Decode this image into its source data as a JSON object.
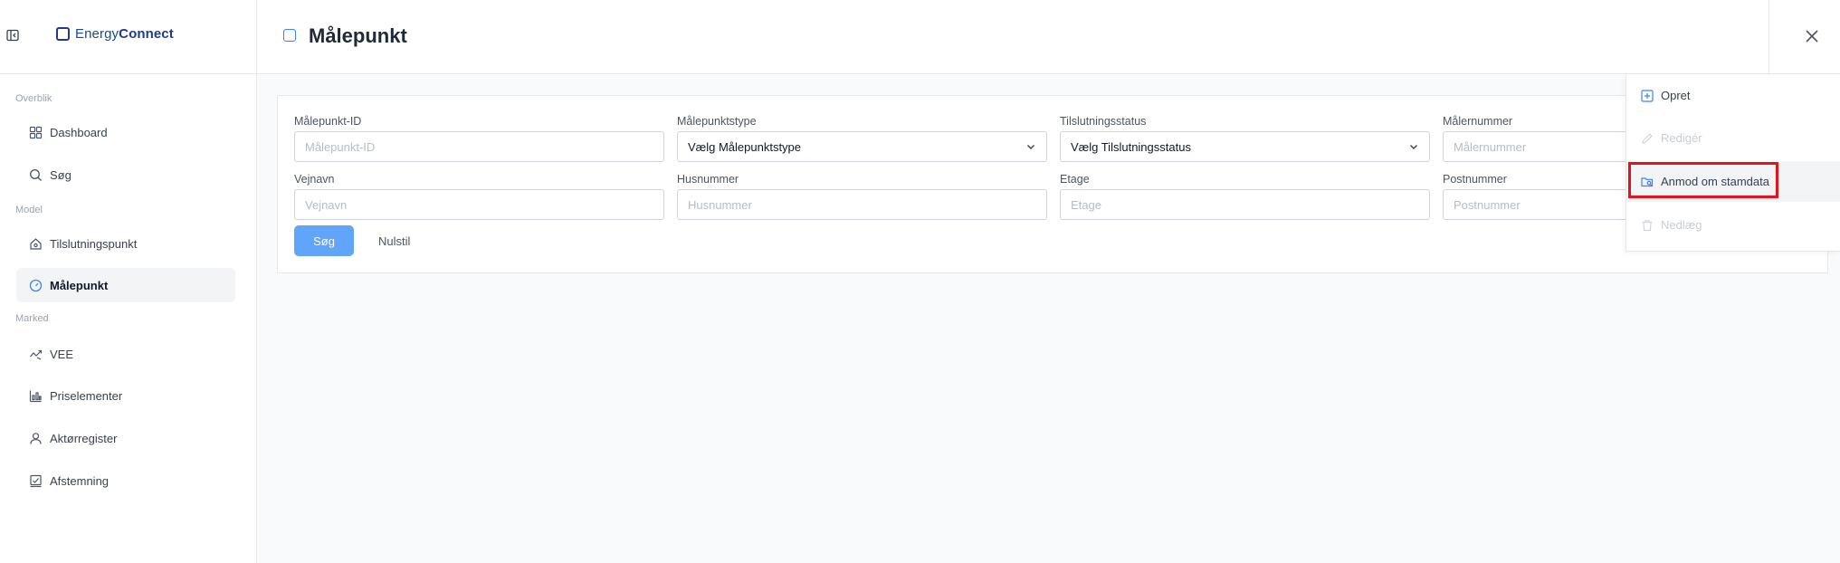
{
  "sidebar": {
    "logo": {
      "prefix": "Energy",
      "suffix": "Connect"
    },
    "sections": {
      "overview": "Overblik",
      "model": "Model",
      "market": "Marked"
    },
    "items": [
      {
        "id": "dashboard",
        "label": "Dashboard",
        "icon": "grid-icon"
      },
      {
        "id": "sog",
        "label": "Søg",
        "icon": "search-icon"
      },
      {
        "id": "tilslutningspunkt",
        "label": "Tilslutningspunkt",
        "icon": "home-icon"
      },
      {
        "id": "malepunkt",
        "label": "Målepunkt",
        "icon": "gauge-icon",
        "active": true
      },
      {
        "id": "vee",
        "label": "VEE",
        "icon": "trend-icon"
      },
      {
        "id": "priselementer",
        "label": "Priselementer",
        "icon": "chart-icon"
      },
      {
        "id": "aktorregister",
        "label": "Aktørregister",
        "icon": "user-icon"
      },
      {
        "id": "afstemning",
        "label": "Afstemning",
        "icon": "check-chart-icon"
      }
    ]
  },
  "header": {
    "title": "Målepunkt"
  },
  "filters": {
    "malepunkt_id": {
      "label": "Målepunkt-ID",
      "placeholder": "Målepunkt-ID",
      "value": ""
    },
    "malepunktstype": {
      "label": "Målepunktstype",
      "selected": "Vælg Målepunktstype"
    },
    "tilslutningsstatus": {
      "label": "Tilslutningsstatus",
      "selected": "Vælg Tilslutningsstatus"
    },
    "malernummer": {
      "label": "Målernummer",
      "placeholder": "Målernummer",
      "value": ""
    },
    "vejnavn": {
      "label": "Vejnavn",
      "placeholder": "Vejnavn",
      "value": ""
    },
    "husnummer": {
      "label": "Husnummer",
      "placeholder": "Husnummer",
      "value": ""
    },
    "etage": {
      "label": "Etage",
      "placeholder": "Etage",
      "value": ""
    },
    "postnummer": {
      "label": "Postnummer",
      "placeholder": "Postnummer",
      "value": ""
    },
    "search_label": "Søg",
    "reset_label": "Nulstil"
  },
  "actions": {
    "create": {
      "label": "Opret",
      "disabled": false
    },
    "edit": {
      "label": "Redigér",
      "disabled": true
    },
    "request": {
      "label": "Anmod om stamdata",
      "disabled": false,
      "highlighted": true
    },
    "delete": {
      "label": "Nedlæg",
      "disabled": true
    }
  },
  "colors": {
    "brand": "#1e3a8a",
    "primary_button": "#60a5fa",
    "highlight": "#e5141b",
    "active_nav": "#f3f4f6"
  }
}
